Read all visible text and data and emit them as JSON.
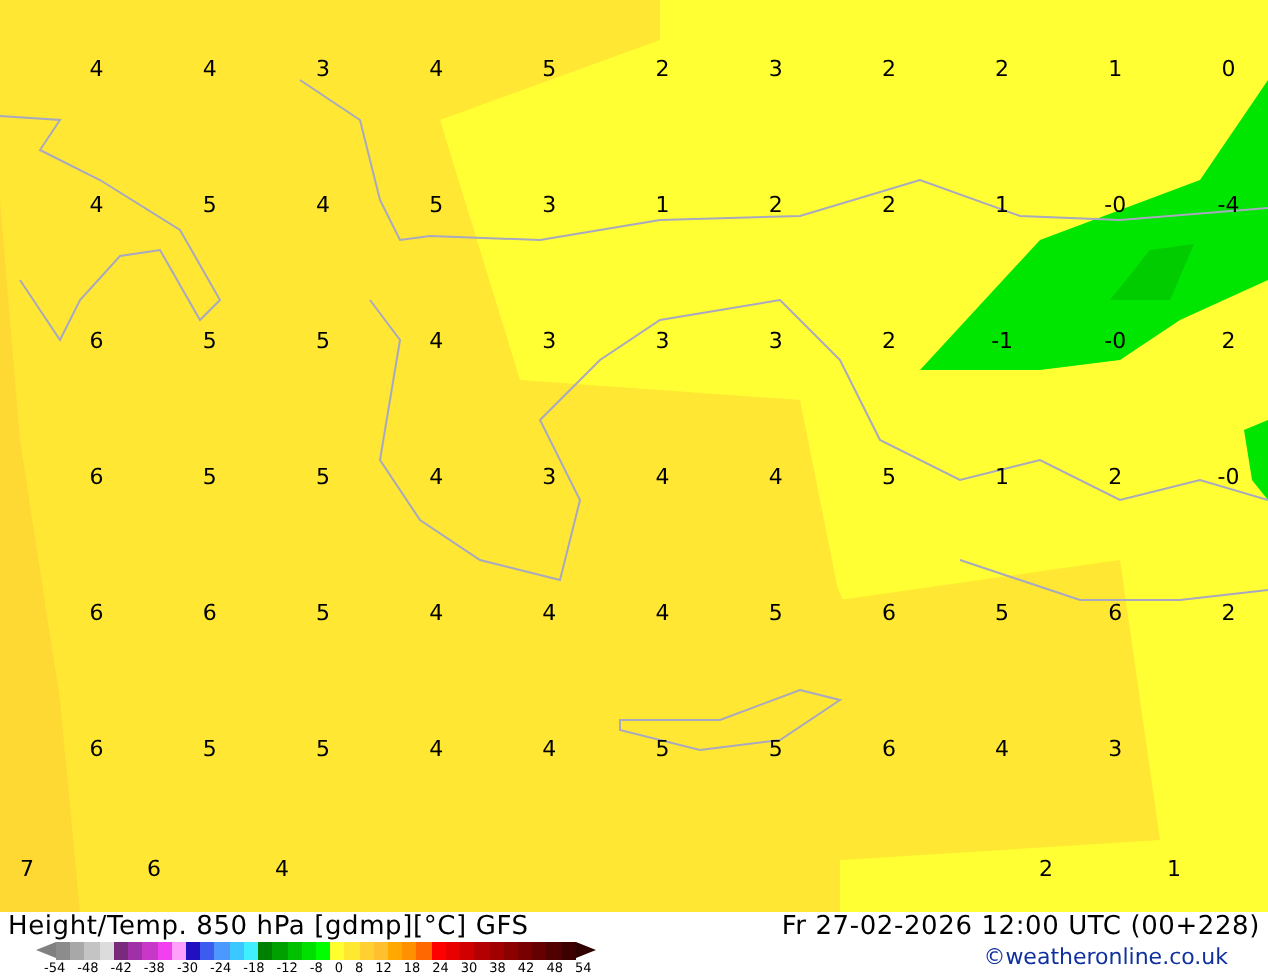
{
  "map": {
    "rows": [
      [
        "4",
        "4",
        "3",
        "4",
        "5",
        "2",
        "3",
        "2",
        "2",
        "1",
        "0"
      ],
      [
        "4",
        "5",
        "4",
        "5",
        "3",
        "1",
        "2",
        "2",
        "1",
        "-0",
        "-4"
      ],
      [
        "6",
        "5",
        "5",
        "4",
        "3",
        "3",
        "3",
        "2",
        "-1",
        "-0",
        "2"
      ],
      [
        "6",
        "5",
        "5",
        "4",
        "3",
        "4",
        "4",
        "5",
        "1",
        "2",
        "-0"
      ],
      [
        "6",
        "6",
        "5",
        "4",
        "4",
        "4",
        "5",
        "6",
        "5",
        "6",
        "2"
      ],
      [
        "6",
        "5",
        "5",
        "4",
        "4",
        "5",
        "5",
        "6",
        "4",
        "3",
        null
      ],
      [
        "7",
        "6",
        "4",
        null,
        null,
        null,
        null,
        null,
        "2",
        "1",
        null
      ]
    ]
  },
  "footer": {
    "title": "Height/Temp. 850 hPa [gdmp][°C] GFS",
    "valid_time": "Fr 27-02-2026 12:00 UTC (00+228)",
    "credit": "©weatheronline.co.uk",
    "legend": {
      "swatches": [
        {
          "color": "#8c8c8c"
        },
        {
          "color": "#a8a8a8"
        },
        {
          "color": "#c4c4c4"
        },
        {
          "color": "#dcdcdc"
        },
        {
          "color": "#7a2a7a"
        },
        {
          "color": "#a030a8"
        },
        {
          "color": "#c838c8"
        },
        {
          "color": "#f040f0"
        },
        {
          "color": "#ffa0ff"
        },
        {
          "color": "#2010c0"
        },
        {
          "color": "#3c5cf0"
        },
        {
          "color": "#4c98ff"
        },
        {
          "color": "#3cc8ff"
        },
        {
          "color": "#40f0ff"
        },
        {
          "color": "#008000"
        },
        {
          "color": "#00a000"
        },
        {
          "color": "#00c000"
        },
        {
          "color": "#00e000"
        },
        {
          "color": "#00ff00"
        },
        {
          "color": "#ffff30"
        },
        {
          "color": "#ffe830"
        },
        {
          "color": "#ffd030"
        },
        {
          "color": "#ffc030"
        },
        {
          "color": "#ffa800"
        },
        {
          "color": "#ff9000"
        },
        {
          "color": "#ff6800"
        },
        {
          "color": "#ff0000"
        },
        {
          "color": "#e80000"
        },
        {
          "color": "#d00000"
        },
        {
          "color": "#b40000"
        },
        {
          "color": "#a00000"
        },
        {
          "color": "#8c0000"
        },
        {
          "color": "#780000"
        },
        {
          "color": "#640000"
        },
        {
          "color": "#500000"
        },
        {
          "color": "#3c0000"
        }
      ],
      "ticks": [
        "-54",
        "-48",
        "-42",
        "-38",
        "-30",
        "-24",
        "-18",
        "-12",
        "-8",
        "0",
        "8",
        "12",
        "18",
        "24",
        "30",
        "38",
        "42",
        "48",
        "54"
      ]
    }
  }
}
